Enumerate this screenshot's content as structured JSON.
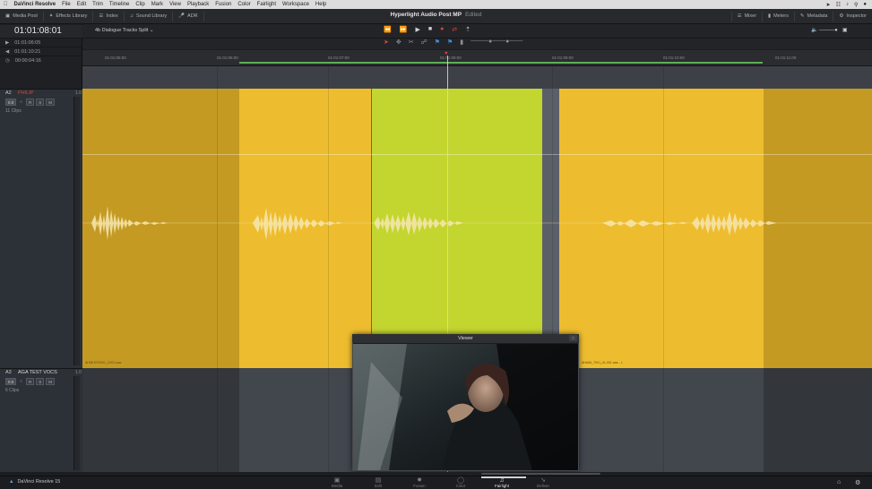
{
  "menubar": {
    "app_name": "DaVinci Resolve",
    "items": [
      "File",
      "Edit",
      "Trim",
      "Timeline",
      "Clip",
      "Mark",
      "View",
      "Playback",
      "Fusion",
      "Color",
      "Fairlight",
      "Workspace",
      "Help"
    ]
  },
  "toolbar": {
    "media_pool": "Media Pool",
    "effects_library": "Effects Library",
    "index": "Index",
    "sound_library": "Sound Library",
    "adr": "ADR",
    "mixer": "Mixer",
    "meters": "Meters",
    "metadata": "Metadata",
    "inspector": "Inspector"
  },
  "project": {
    "title": "Hyperlight Audio Post MP",
    "status": "Edited"
  },
  "timecode": {
    "main": "01:01:08:01",
    "row1": "01:01:06:05",
    "row2": "01:01:10:21",
    "row3": "00:00:04:16"
  },
  "timeline_name": "4b Dialogue Tracks Split",
  "ruler_ticks": [
    "01:01:05:00",
    "01:01:06:00",
    "01:01:07:00",
    "01:01:08:00",
    "01:01:09:00",
    "01:01:10:00",
    "01:01:11:00"
  ],
  "tracks": [
    {
      "id": "A2",
      "name": "PHILIP",
      "num": "1.0",
      "volume": "0.0",
      "clips": "11 Clips",
      "name_color": "#d9443c"
    },
    {
      "id": "A3",
      "name": "AGA TEST VOCS",
      "num": "1.0",
      "volume": "0.5",
      "clips": "6 Clips",
      "name_color": "#d8d9dc"
    }
  ],
  "track_buttons": [
    "R",
    "S",
    "M"
  ],
  "clip_labels": {
    "left": "AH08 KIT0001_C001.wav",
    "right": "AHA06_T001_01-001.wav - L"
  },
  "viewer": {
    "title": "Viewer"
  },
  "pages": [
    {
      "icon": "media-icon",
      "label": "Media"
    },
    {
      "icon": "edit-icon",
      "label": "Edit"
    },
    {
      "icon": "fusion-icon",
      "label": "Fusion"
    },
    {
      "icon": "color-icon",
      "label": "Color"
    },
    {
      "icon": "fairlight-icon",
      "label": "Fairlight"
    },
    {
      "icon": "deliver-icon",
      "label": "Deliver"
    }
  ],
  "active_page": "Fairlight",
  "brand": "DaVinci Resolve 15",
  "colors": {
    "clip_yellow": "#eebd2f",
    "clip_dim": "#c49a23",
    "clip_green": "#c3d52f",
    "accent_red": "#d9443c",
    "accent_blue": "#3f8fe0"
  }
}
